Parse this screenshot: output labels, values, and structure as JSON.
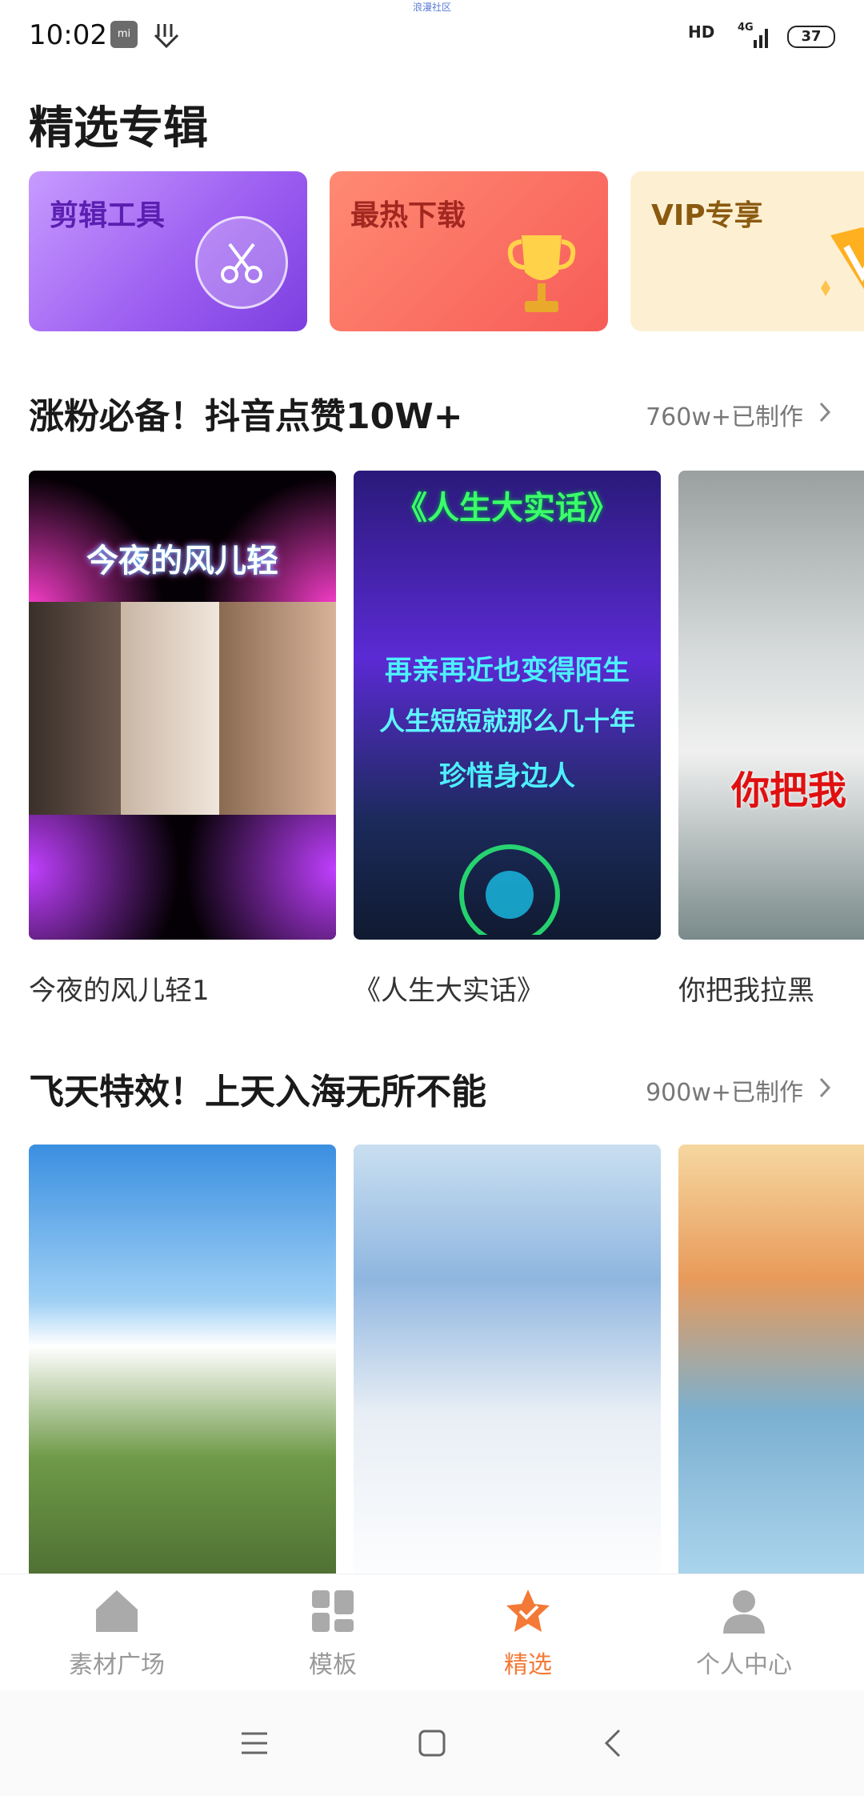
{
  "status_bar": {
    "banner": "浪漫社区",
    "time": "10:02",
    "hd": "HD",
    "network": "4G",
    "battery": "37"
  },
  "page_title": "精选专辑",
  "albums": [
    {
      "label": "剪辑工具"
    },
    {
      "label": "最热下载"
    },
    {
      "label": "VIP专享"
    }
  ],
  "sections": [
    {
      "title": "涨粉必备！抖音点赞10W+",
      "count": "760w+已制作",
      "items": [
        {
          "title": "今夜的风儿轻1",
          "overlay": "今夜的风儿轻"
        },
        {
          "title": "《人生大实话》",
          "overlay": "《人生大实话》",
          "lines": [
            "再亲再近也变得陌生",
            "人生短短就那么几十年",
            "珍惜身边人"
          ]
        },
        {
          "title": "你把我拉黑",
          "overlay": "你把我"
        }
      ]
    },
    {
      "title": "飞天特效！上天入海无所不能",
      "count": "900w+已制作",
      "items": [
        {
          "title": ""
        },
        {
          "title": ""
        },
        {
          "title": ""
        }
      ]
    }
  ],
  "bottom_nav": [
    {
      "label": "素材广场",
      "icon": "home-icon"
    },
    {
      "label": "模板",
      "icon": "grid-icon"
    },
    {
      "label": "精选",
      "icon": "star-icon",
      "active": true
    },
    {
      "label": "个人中心",
      "icon": "person-icon"
    }
  ],
  "colors": {
    "accent": "#f37a36",
    "nav_inactive": "#999999"
  }
}
